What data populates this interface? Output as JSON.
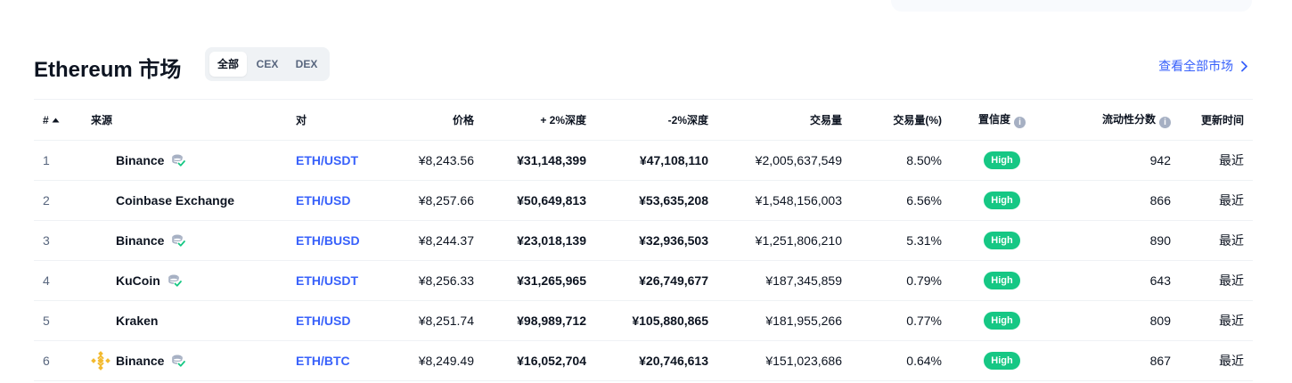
{
  "header": {
    "title": "Ethereum 市场",
    "tabs": [
      "全部",
      "CEX",
      "DEX"
    ],
    "active_tab": "全部",
    "view_all": "查看全部市场"
  },
  "columns": {
    "idx": "#",
    "source": "来源",
    "pair": "对",
    "price": "价格",
    "depth_plus": "+ 2%深度",
    "depth_minus": "-2%深度",
    "volume": "交易量",
    "volume_pct": "交易量(%)",
    "confidence": "置信度",
    "liquidity": "流动性分数",
    "updated": "更新时间"
  },
  "rows": [
    {
      "idx": "1",
      "source": "Binance",
      "verified": true,
      "logo": "none",
      "pair": "ETH/USDT",
      "price": "¥8,243.56",
      "depth_plus": "¥31,148,399",
      "depth_minus": "¥47,108,110",
      "volume": "¥2,005,637,549",
      "volume_pct": "8.50%",
      "confidence": "High",
      "liquidity": "942",
      "updated": "最近"
    },
    {
      "idx": "2",
      "source": "Coinbase Exchange",
      "verified": false,
      "logo": "none",
      "pair": "ETH/USD",
      "price": "¥8,257.66",
      "depth_plus": "¥50,649,813",
      "depth_minus": "¥53,635,208",
      "volume": "¥1,548,156,003",
      "volume_pct": "6.56%",
      "confidence": "High",
      "liquidity": "866",
      "updated": "最近"
    },
    {
      "idx": "3",
      "source": "Binance",
      "verified": true,
      "logo": "none",
      "pair": "ETH/BUSD",
      "price": "¥8,244.37",
      "depth_plus": "¥23,018,139",
      "depth_minus": "¥32,936,503",
      "volume": "¥1,251,806,210",
      "volume_pct": "5.31%",
      "confidence": "High",
      "liquidity": "890",
      "updated": "最近"
    },
    {
      "idx": "4",
      "source": "KuCoin",
      "verified": true,
      "logo": "none",
      "pair": "ETH/USDT",
      "price": "¥8,256.33",
      "depth_plus": "¥31,265,965",
      "depth_minus": "¥26,749,677",
      "volume": "¥187,345,859",
      "volume_pct": "0.79%",
      "confidence": "High",
      "liquidity": "643",
      "updated": "最近"
    },
    {
      "idx": "5",
      "source": "Kraken",
      "verified": false,
      "logo": "none",
      "pair": "ETH/USD",
      "price": "¥8,251.74",
      "depth_plus": "¥98,989,712",
      "depth_minus": "¥105,880,865",
      "volume": "¥181,955,266",
      "volume_pct": "0.77%",
      "confidence": "High",
      "liquidity": "809",
      "updated": "最近"
    },
    {
      "idx": "6",
      "source": "Binance",
      "verified": true,
      "logo": "binance-logo",
      "pair": "ETH/BTC",
      "price": "¥8,249.49",
      "depth_plus": "¥16,052,704",
      "depth_minus": "¥20,746,613",
      "volume": "¥151,023,686",
      "volume_pct": "0.64%",
      "confidence": "High",
      "liquidity": "867",
      "updated": "最近"
    }
  ],
  "colors": {
    "accent": "#3861fb",
    "high_badge": "#16c784",
    "binance": "#f3ba2f"
  }
}
